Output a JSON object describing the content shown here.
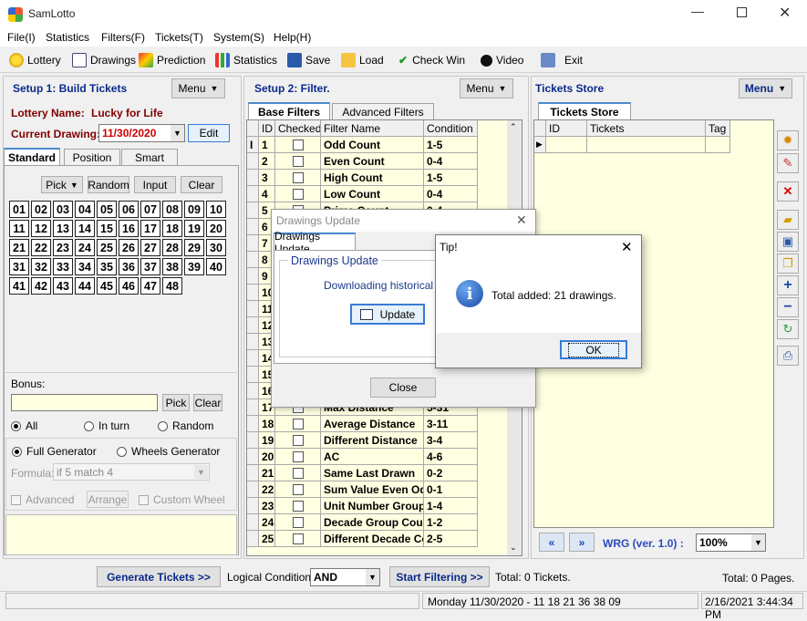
{
  "app": {
    "title": "SamLotto"
  },
  "menu": [
    "File(I)",
    "Statistics",
    "Filters(F)",
    "Tickets(T)",
    "System(S)",
    "Help(H)"
  ],
  "toolbar": {
    "lottery": "Lottery",
    "drawings": "Drawings",
    "prediction": "Prediction",
    "statistics": "Statistics",
    "save": "Save",
    "load": "Load",
    "check_win": "Check Win",
    "video": "Video",
    "exit": "Exit"
  },
  "setup1": {
    "title": "Setup 1: Build  Tickets",
    "menu": "Menu",
    "lottery_label": "Lottery  Name:",
    "lottery_name": "Lucky for Life",
    "drawing_label": "Current Drawing:",
    "drawing_date": "11/30/2020",
    "edit": "Edit",
    "tabs": [
      "Standard",
      "Position",
      "Smart"
    ],
    "pick": "Pick",
    "random": "Random",
    "input": "Input",
    "clear": "Clear",
    "numbers": [
      "01",
      "02",
      "03",
      "04",
      "05",
      "06",
      "07",
      "08",
      "09",
      "10",
      "11",
      "12",
      "13",
      "14",
      "15",
      "16",
      "17",
      "18",
      "19",
      "20",
      "21",
      "22",
      "23",
      "24",
      "25",
      "26",
      "27",
      "28",
      "29",
      "30",
      "31",
      "32",
      "33",
      "34",
      "35",
      "36",
      "37",
      "38",
      "39",
      "40",
      "41",
      "42",
      "43",
      "44",
      "45",
      "46",
      "47",
      "48"
    ],
    "bonus_label": "Bonus:",
    "bonus_pick": "Pick",
    "bonus_clear": "Clear",
    "mode_all": "All",
    "mode_inturn": "In turn",
    "mode_random": "Random",
    "full_gen": "Full Generator",
    "wheels_gen": "Wheels Generator",
    "formula_label": "Formula:",
    "formula_value": "if 5 match 4",
    "advanced": "Advanced",
    "arrange": "Arrange",
    "custom_wheel": "Custom Wheel"
  },
  "setup2": {
    "title": "Setup 2: Filter.",
    "menu": "Menu",
    "tabs": [
      "Base Filters",
      "Advanced Filters"
    ],
    "columns": [
      "ID",
      "Checked",
      "Filter Name",
      "Condition"
    ],
    "rows": [
      [
        "1",
        "Odd Count",
        "1-5"
      ],
      [
        "2",
        "Even Count",
        "0-4"
      ],
      [
        "3",
        "High Count",
        "1-5"
      ],
      [
        "4",
        "Low Count",
        "0-4"
      ],
      [
        "5",
        "Prime Count",
        "0-4"
      ],
      [
        "6",
        "",
        ""
      ],
      [
        "7",
        "",
        ""
      ],
      [
        "8",
        "",
        ""
      ],
      [
        "9",
        "",
        ""
      ],
      [
        "10",
        "",
        ""
      ],
      [
        "11",
        "",
        ""
      ],
      [
        "12",
        "",
        ""
      ],
      [
        "13",
        "",
        ""
      ],
      [
        "14",
        "",
        ""
      ],
      [
        "15",
        "",
        ""
      ],
      [
        "16",
        "",
        ""
      ],
      [
        "17",
        "Max Distance",
        "5-31"
      ],
      [
        "18",
        "Average Distance",
        "3-11"
      ],
      [
        "19",
        "Different Distance",
        "3-4"
      ],
      [
        "20",
        "AC",
        "4-6"
      ],
      [
        "21",
        "Same Last Drawn",
        "0-2"
      ],
      [
        "22",
        "Sum Value Even Odd",
        "0-1"
      ],
      [
        "23",
        "Unit Number Group",
        "1-4"
      ],
      [
        "24",
        "Decade Group Count",
        "1-2"
      ],
      [
        "25",
        "Different Decade Count",
        "2-5"
      ]
    ]
  },
  "store": {
    "title": "Tickets Store",
    "menu": "Menu",
    "tab": "Tickets Store",
    "columns": [
      "ID",
      "Tickets",
      "Tag"
    ],
    "version": "WRG (ver. 1.0) :",
    "zoom": "100%"
  },
  "bottom": {
    "generate": "Generate Tickets >>",
    "logical_label": "Logical Condition:",
    "logical_value": "AND",
    "start_filtering": "Start Filtering >>",
    "total_tickets": "Total: 0 Tickets.",
    "total_pages": "Total: 0 Pages."
  },
  "status": {
    "draw": "Monday 11/30/2020 - 11 18 21 36 38 09",
    "datetime": "2/16/2021 3:44:34 PM"
  },
  "drawings_dialog": {
    "title": "Drawings Update",
    "tab": "Drawings Update",
    "group": "Drawings Update",
    "message": "Downloading historical data",
    "update": "Update",
    "close": "Close"
  },
  "tip_dialog": {
    "title": "Tip!",
    "message": "Total added: 21 drawings.",
    "ok": "OK"
  },
  "colors": {
    "panel_yellow": "#ffffe1",
    "title_blue": "#0a2a8a",
    "maroon": "#800000",
    "drawing_red": "#cc0000"
  }
}
